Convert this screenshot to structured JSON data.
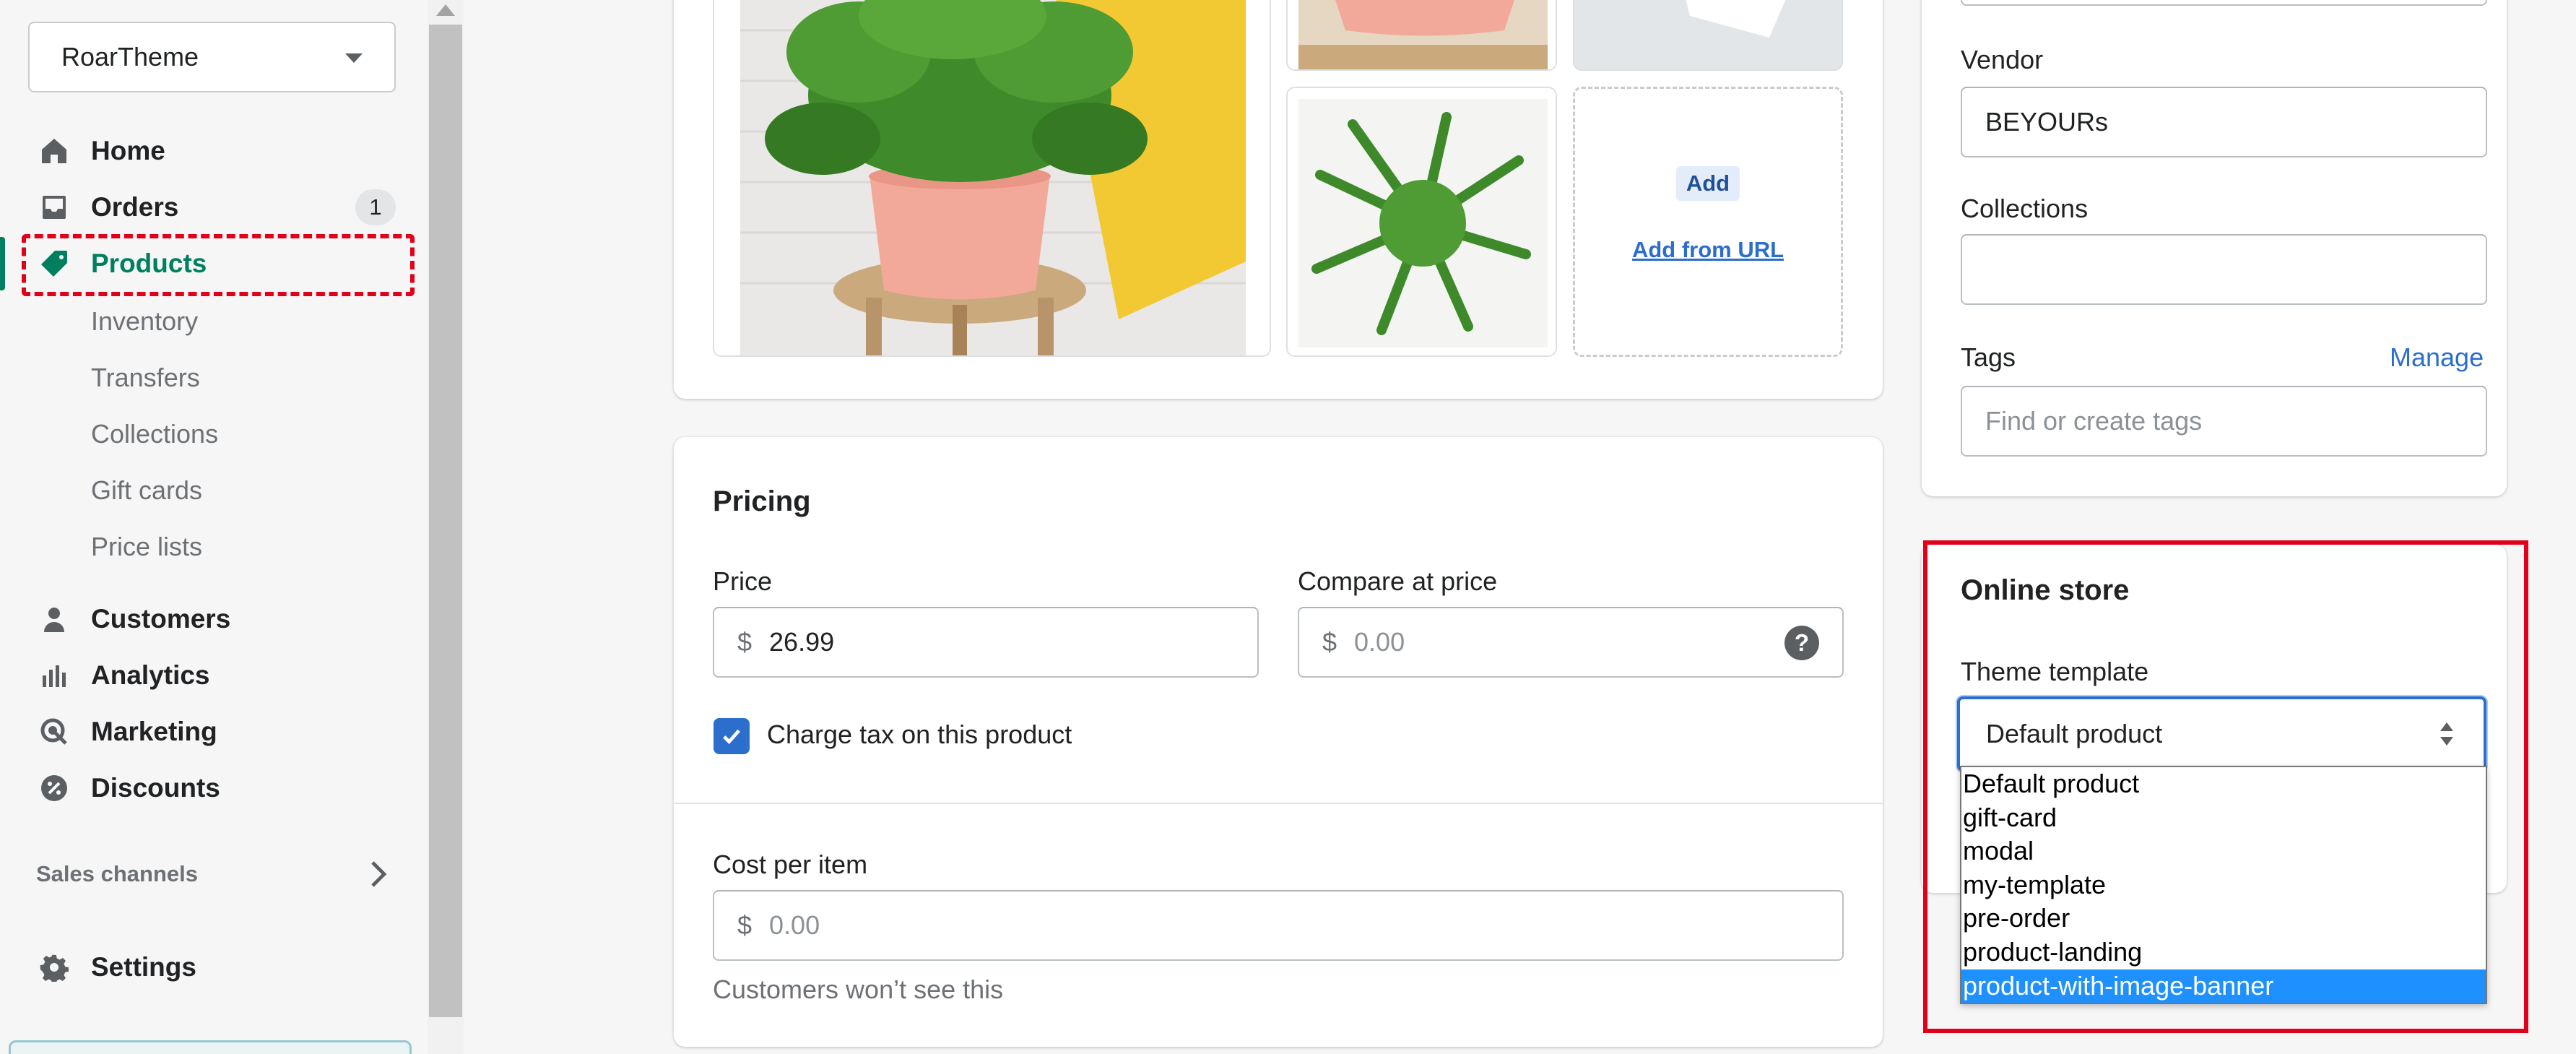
{
  "sidebar": {
    "store_name": "RoarTheme",
    "nav": [
      {
        "label": "Home",
        "icon": "home-icon"
      },
      {
        "label": "Orders",
        "icon": "orders-inbox-icon",
        "badge": "1"
      },
      {
        "label": "Products",
        "icon": "tag-icon",
        "active": true
      },
      {
        "label": "Customers",
        "icon": "person-icon"
      },
      {
        "label": "Analytics",
        "icon": "bar-chart-icon"
      },
      {
        "label": "Marketing",
        "icon": "target-icon"
      },
      {
        "label": "Discounts",
        "icon": "discount-icon"
      }
    ],
    "products_sub": [
      "Inventory",
      "Transfers",
      "Collections",
      "Gift cards",
      "Price lists"
    ],
    "sales_channels_label": "Sales channels",
    "settings_label": "Settings"
  },
  "media": {
    "add_button_label": "Add",
    "add_from_url_label": "Add from URL"
  },
  "pricing": {
    "title": "Pricing",
    "price_label": "Price",
    "price_prefix": "$",
    "price_value": "26.99",
    "compare_label": "Compare at price",
    "compare_prefix": "$",
    "compare_placeholder": "0.00",
    "charge_tax_label": "Charge tax on this product",
    "charge_tax_checked": true,
    "cost_label": "Cost per item",
    "cost_prefix": "$",
    "cost_placeholder": "0.00",
    "cost_help": "Customers won’t see this"
  },
  "organization": {
    "vendor_label": "Vendor",
    "vendor_value": "BEYOURs",
    "collections_label": "Collections",
    "collections_value": "",
    "tags_label": "Tags",
    "tags_manage_label": "Manage",
    "tags_placeholder": "Find or create tags"
  },
  "online_store": {
    "title": "Online store",
    "theme_template_label": "Theme template",
    "selected_template": "Default product",
    "options": [
      "Default product",
      "gift-card",
      "modal",
      "my-template",
      "pre-order",
      "product-landing",
      "product-with-image-banner"
    ],
    "highlighted_option": "product-with-image-banner"
  },
  "colors": {
    "accent_green": "#008060",
    "link_blue": "#2c6ecb",
    "highlight_red": "#e0001a",
    "option_highlight": "#1e90ff"
  }
}
